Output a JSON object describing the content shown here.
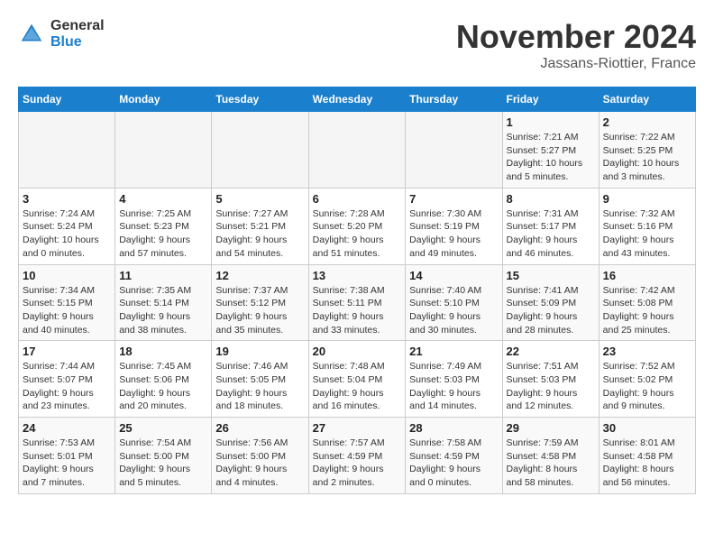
{
  "logo": {
    "general": "General",
    "blue": "Blue"
  },
  "header": {
    "month": "November 2024",
    "location": "Jassans-Riottier, France"
  },
  "weekdays": [
    "Sunday",
    "Monday",
    "Tuesday",
    "Wednesday",
    "Thursday",
    "Friday",
    "Saturday"
  ],
  "weeks": [
    [
      {
        "day": "",
        "info": ""
      },
      {
        "day": "",
        "info": ""
      },
      {
        "day": "",
        "info": ""
      },
      {
        "day": "",
        "info": ""
      },
      {
        "day": "",
        "info": ""
      },
      {
        "day": "1",
        "info": "Sunrise: 7:21 AM\nSunset: 5:27 PM\nDaylight: 10 hours and 5 minutes."
      },
      {
        "day": "2",
        "info": "Sunrise: 7:22 AM\nSunset: 5:25 PM\nDaylight: 10 hours and 3 minutes."
      }
    ],
    [
      {
        "day": "3",
        "info": "Sunrise: 7:24 AM\nSunset: 5:24 PM\nDaylight: 10 hours and 0 minutes."
      },
      {
        "day": "4",
        "info": "Sunrise: 7:25 AM\nSunset: 5:23 PM\nDaylight: 9 hours and 57 minutes."
      },
      {
        "day": "5",
        "info": "Sunrise: 7:27 AM\nSunset: 5:21 PM\nDaylight: 9 hours and 54 minutes."
      },
      {
        "day": "6",
        "info": "Sunrise: 7:28 AM\nSunset: 5:20 PM\nDaylight: 9 hours and 51 minutes."
      },
      {
        "day": "7",
        "info": "Sunrise: 7:30 AM\nSunset: 5:19 PM\nDaylight: 9 hours and 49 minutes."
      },
      {
        "day": "8",
        "info": "Sunrise: 7:31 AM\nSunset: 5:17 PM\nDaylight: 9 hours and 46 minutes."
      },
      {
        "day": "9",
        "info": "Sunrise: 7:32 AM\nSunset: 5:16 PM\nDaylight: 9 hours and 43 minutes."
      }
    ],
    [
      {
        "day": "10",
        "info": "Sunrise: 7:34 AM\nSunset: 5:15 PM\nDaylight: 9 hours and 40 minutes."
      },
      {
        "day": "11",
        "info": "Sunrise: 7:35 AM\nSunset: 5:14 PM\nDaylight: 9 hours and 38 minutes."
      },
      {
        "day": "12",
        "info": "Sunrise: 7:37 AM\nSunset: 5:12 PM\nDaylight: 9 hours and 35 minutes."
      },
      {
        "day": "13",
        "info": "Sunrise: 7:38 AM\nSunset: 5:11 PM\nDaylight: 9 hours and 33 minutes."
      },
      {
        "day": "14",
        "info": "Sunrise: 7:40 AM\nSunset: 5:10 PM\nDaylight: 9 hours and 30 minutes."
      },
      {
        "day": "15",
        "info": "Sunrise: 7:41 AM\nSunset: 5:09 PM\nDaylight: 9 hours and 28 minutes."
      },
      {
        "day": "16",
        "info": "Sunrise: 7:42 AM\nSunset: 5:08 PM\nDaylight: 9 hours and 25 minutes."
      }
    ],
    [
      {
        "day": "17",
        "info": "Sunrise: 7:44 AM\nSunset: 5:07 PM\nDaylight: 9 hours and 23 minutes."
      },
      {
        "day": "18",
        "info": "Sunrise: 7:45 AM\nSunset: 5:06 PM\nDaylight: 9 hours and 20 minutes."
      },
      {
        "day": "19",
        "info": "Sunrise: 7:46 AM\nSunset: 5:05 PM\nDaylight: 9 hours and 18 minutes."
      },
      {
        "day": "20",
        "info": "Sunrise: 7:48 AM\nSunset: 5:04 PM\nDaylight: 9 hours and 16 minutes."
      },
      {
        "day": "21",
        "info": "Sunrise: 7:49 AM\nSunset: 5:03 PM\nDaylight: 9 hours and 14 minutes."
      },
      {
        "day": "22",
        "info": "Sunrise: 7:51 AM\nSunset: 5:03 PM\nDaylight: 9 hours and 12 minutes."
      },
      {
        "day": "23",
        "info": "Sunrise: 7:52 AM\nSunset: 5:02 PM\nDaylight: 9 hours and 9 minutes."
      }
    ],
    [
      {
        "day": "24",
        "info": "Sunrise: 7:53 AM\nSunset: 5:01 PM\nDaylight: 9 hours and 7 minutes."
      },
      {
        "day": "25",
        "info": "Sunrise: 7:54 AM\nSunset: 5:00 PM\nDaylight: 9 hours and 5 minutes."
      },
      {
        "day": "26",
        "info": "Sunrise: 7:56 AM\nSunset: 5:00 PM\nDaylight: 9 hours and 4 minutes."
      },
      {
        "day": "27",
        "info": "Sunrise: 7:57 AM\nSunset: 4:59 PM\nDaylight: 9 hours and 2 minutes."
      },
      {
        "day": "28",
        "info": "Sunrise: 7:58 AM\nSunset: 4:59 PM\nDaylight: 9 hours and 0 minutes."
      },
      {
        "day": "29",
        "info": "Sunrise: 7:59 AM\nSunset: 4:58 PM\nDaylight: 8 hours and 58 minutes."
      },
      {
        "day": "30",
        "info": "Sunrise: 8:01 AM\nSunset: 4:58 PM\nDaylight: 8 hours and 56 minutes."
      }
    ]
  ]
}
